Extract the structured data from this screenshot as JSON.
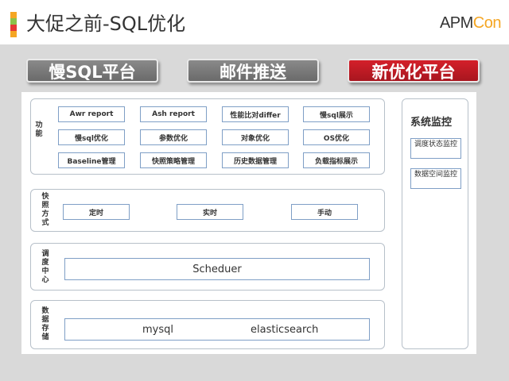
{
  "header": {
    "title": "大促之前-SQL优化",
    "logo_prefix": "APM",
    "logo_suffix": "Con"
  },
  "tabs": [
    {
      "label": "慢SQL平台",
      "color": "#7a7a7a"
    },
    {
      "label": "邮件推送",
      "color": "#7a7a7a"
    },
    {
      "label": "新优化平台",
      "color": "#c0191f"
    }
  ],
  "sections": {
    "function": {
      "label": "功能",
      "items": [
        "Awr report",
        "Ash report",
        "性能比对differ",
        "慢sql展示",
        "慢sql优化",
        "参数优化",
        "对象优化",
        "OS优化",
        "Baseline管理",
        "快照策略管理",
        "历史数据管理",
        "负载指标展示"
      ]
    },
    "snapshot": {
      "label": "快照方式",
      "items": [
        "定时",
        "实时",
        "手动"
      ]
    },
    "scheduler": {
      "label": "调度中心",
      "item": "Scheduer"
    },
    "storage": {
      "label": "数据存储",
      "items": [
        "mysql",
        "elasticsearch"
      ]
    },
    "monitor": {
      "title": "系统监控",
      "items": [
        "调度状态监控",
        "数据空间监控"
      ]
    }
  }
}
